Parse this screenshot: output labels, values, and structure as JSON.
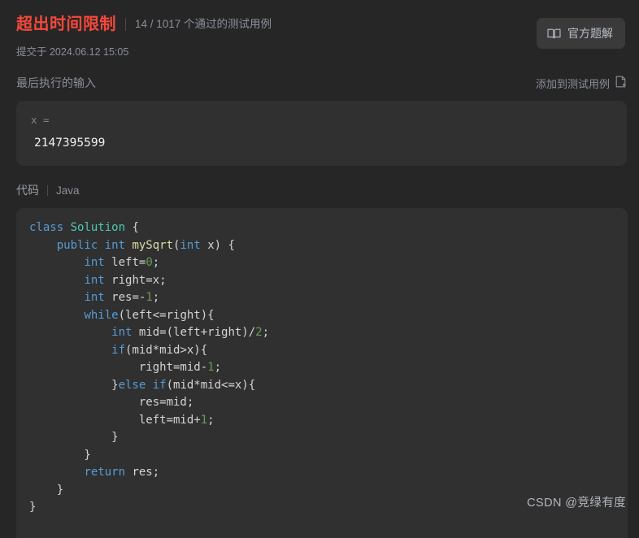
{
  "header": {
    "status_title": "超出时间限制",
    "status_color": "#f5483b",
    "testcase_count": "14 / 1017 个通过的测试用例",
    "submit_time": "提交于 2024.06.12 15:05",
    "solution_button": {
      "label": "官方题解",
      "icon": "book-icon"
    }
  },
  "last_input": {
    "section_title": "最后执行的输入",
    "add_testcase": {
      "label": "添加到测试用例",
      "icon": "add-to-testcase-icon"
    },
    "variable_label": "x =",
    "variable_value": "2147395599"
  },
  "code_section": {
    "section_title": "代码",
    "language": "Java",
    "lines": [
      [
        {
          "t": "class ",
          "c": "kw"
        },
        {
          "t": "Solution",
          "c": "typ"
        },
        {
          "t": " {",
          "c": "pln"
        }
      ],
      [
        {
          "t": "    ",
          "c": "pln"
        },
        {
          "t": "public ",
          "c": "kw"
        },
        {
          "t": "int ",
          "c": "kw"
        },
        {
          "t": "mySqrt",
          "c": "fn"
        },
        {
          "t": "(",
          "c": "pln"
        },
        {
          "t": "int ",
          "c": "kw"
        },
        {
          "t": "x) {",
          "c": "pln"
        }
      ],
      [
        {
          "t": "        ",
          "c": "pln"
        },
        {
          "t": "int ",
          "c": "kw"
        },
        {
          "t": "left=",
          "c": "pln"
        },
        {
          "t": "0",
          "c": "num"
        },
        {
          "t": ";",
          "c": "pln"
        }
      ],
      [
        {
          "t": "        ",
          "c": "pln"
        },
        {
          "t": "int ",
          "c": "kw"
        },
        {
          "t": "right=x;",
          "c": "pln"
        }
      ],
      [
        {
          "t": "        ",
          "c": "pln"
        },
        {
          "t": "int ",
          "c": "kw"
        },
        {
          "t": "res=-",
          "c": "pln"
        },
        {
          "t": "1",
          "c": "num"
        },
        {
          "t": ";",
          "c": "pln"
        }
      ],
      [
        {
          "t": "        ",
          "c": "pln"
        },
        {
          "t": "while",
          "c": "kw"
        },
        {
          "t": "(left<=right){",
          "c": "pln"
        }
      ],
      [
        {
          "t": "            ",
          "c": "pln"
        },
        {
          "t": "int ",
          "c": "kw"
        },
        {
          "t": "mid=(left+right)/",
          "c": "pln"
        },
        {
          "t": "2",
          "c": "num"
        },
        {
          "t": ";",
          "c": "pln"
        }
      ],
      [
        {
          "t": "            ",
          "c": "pln"
        },
        {
          "t": "if",
          "c": "kw"
        },
        {
          "t": "(mid*mid>x){",
          "c": "pln"
        }
      ],
      [
        {
          "t": "                ",
          "c": "pln"
        },
        {
          "t": "right=mid-",
          "c": "pln"
        },
        {
          "t": "1",
          "c": "num"
        },
        {
          "t": ";",
          "c": "pln"
        }
      ],
      [
        {
          "t": "            }",
          "c": "pln"
        },
        {
          "t": "else ",
          "c": "kw"
        },
        {
          "t": "if",
          "c": "kw"
        },
        {
          "t": "(mid*mid<=x){",
          "c": "pln"
        }
      ],
      [
        {
          "t": "                res=mid;",
          "c": "pln"
        }
      ],
      [
        {
          "t": "                left=mid+",
          "c": "pln"
        },
        {
          "t": "1",
          "c": "num"
        },
        {
          "t": ";",
          "c": "pln"
        }
      ],
      [
        {
          "t": "            }",
          "c": "pln"
        }
      ],
      [
        {
          "t": "        }",
          "c": "pln"
        }
      ],
      [
        {
          "t": "        ",
          "c": "pln"
        },
        {
          "t": "return ",
          "c": "kw"
        },
        {
          "t": "res;",
          "c": "pln"
        }
      ],
      [
        {
          "t": "    }",
          "c": "pln"
        }
      ],
      [
        {
          "t": "}",
          "c": "pln"
        }
      ]
    ]
  },
  "watermark": "CSDN @竞绿有度"
}
